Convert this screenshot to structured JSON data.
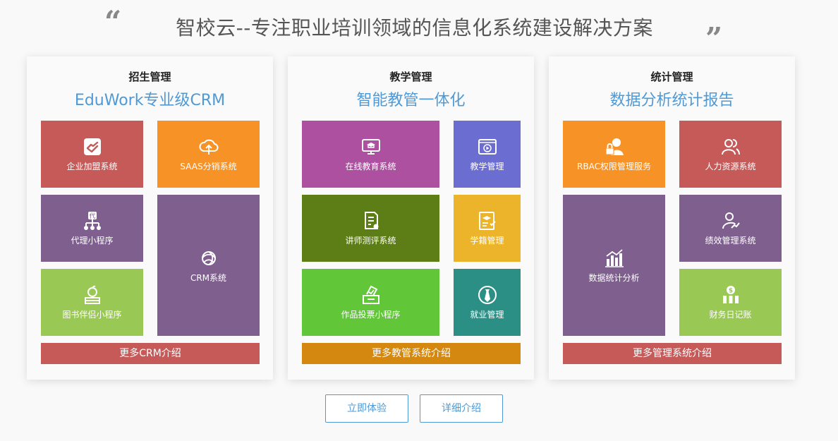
{
  "headline": "智校云--专注职业培训领域的信息化系统建设解决方案",
  "quote_open": "“",
  "quote_close": "”",
  "cards": [
    {
      "title": "招生管理",
      "subtitle": "EduWork专业级CRM",
      "more": "更多CRM介绍",
      "more_color": "#c65a59",
      "tiles": [
        {
          "label": "企业加盟系统",
          "icon": "handshake-icon",
          "color": "#c65a59"
        },
        {
          "label": "SAAS分销系统",
          "icon": "cloud-share-icon",
          "color": "#f79226"
        },
        {
          "label": "代理小程序",
          "icon": "agent-tree-icon",
          "color": "#7e5f8e"
        },
        {
          "label": "CRM系统",
          "icon": "crm-swirl-icon",
          "color": "#7e5f8e"
        },
        {
          "label": "图书伴侣小程序",
          "icon": "apple-book-icon",
          "color": "#9ac854"
        }
      ]
    },
    {
      "title": "教学管理",
      "subtitle": "智能教管一体化",
      "more": "更多教管系统介绍",
      "more_color": "#d4880f",
      "tiles": [
        {
          "label": "在线教育系统",
          "icon": "monitor-graduation-icon",
          "color": "#ad50a0"
        },
        {
          "label": "教学管理",
          "icon": "video-play-icon",
          "color": "#6c6dd1"
        },
        {
          "label": "讲师测评系统",
          "icon": "document-check-icon",
          "color": "#5d7d17"
        },
        {
          "label": "学籍管理",
          "icon": "student-card-icon",
          "color": "#ecb42a"
        },
        {
          "label": "作品投票小程序",
          "icon": "ballot-box-icon",
          "color": "#62c738"
        },
        {
          "label": "就业管理",
          "icon": "tie-icon",
          "color": "#2b8f86"
        }
      ]
    },
    {
      "title": "统计管理",
      "subtitle": "数据分析统计报告",
      "more": "更多管理系统介绍",
      "more_color": "#c65a59",
      "tiles": [
        {
          "label": "RBAC权限管理服务",
          "icon": "user-lock-icon",
          "color": "#f79226"
        },
        {
          "label": "人力资源系统",
          "icon": "team-icon",
          "color": "#c65a59"
        },
        {
          "label": "数据统计分析",
          "icon": "bar-chart-icon",
          "color": "#7e5f8e"
        },
        {
          "label": "绩效管理系统",
          "icon": "user-trend-icon",
          "color": "#7e5f8e"
        },
        {
          "label": "财务日记账",
          "icon": "money-bars-icon",
          "color": "#9ac854"
        }
      ]
    }
  ],
  "actions": {
    "try": "立即体验",
    "details": "详细介绍"
  }
}
